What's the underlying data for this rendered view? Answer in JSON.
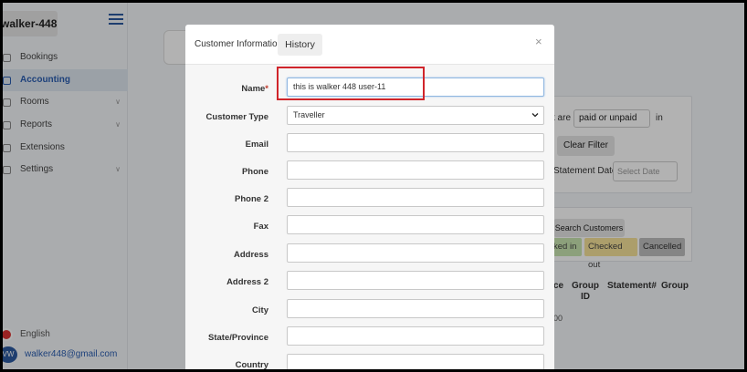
{
  "sidebar": {
    "brand": "walker-448",
    "items": [
      {
        "label": "Bookings",
        "icon": "book-icon",
        "active": false,
        "has_chevron": false
      },
      {
        "label": "Accounting",
        "icon": "user-icon",
        "active": true,
        "has_chevron": false
      },
      {
        "label": "Rooms",
        "icon": "bed-icon",
        "active": false,
        "has_chevron": true
      },
      {
        "label": "Reports",
        "icon": "report-icon",
        "active": false,
        "has_chevron": true
      },
      {
        "label": "Extensions",
        "icon": "extension-icon",
        "active": false,
        "has_chevron": false
      },
      {
        "label": "Settings",
        "icon": "gear-icon",
        "active": false,
        "has_chevron": true
      }
    ],
    "language": "English",
    "user_email": "walker448@gmail.com",
    "avatar_initials": "VW"
  },
  "background": {
    "filter_are_label": "t are",
    "paid_select": "paid or unpaid",
    "in_label": "in",
    "clear_filter": "Clear Filter",
    "statement_date_label": "Statement Date",
    "select_date_placeholder": "Select Date",
    "search_customers": "Search Customers",
    "chips": {
      "checked_in": "ked in",
      "checked_out": "Checked out",
      "cancelled": "Cancelled"
    },
    "table_headers": [
      "ce",
      "Group ID",
      "Statement#",
      "Group"
    ],
    "cell_partial": "00"
  },
  "modal": {
    "tab_info": "Customer Information",
    "tab_history": "History",
    "close": "×",
    "fields": [
      {
        "label": "Name",
        "required": true,
        "value": "this is walker 448 user-11",
        "type": "text"
      },
      {
        "label": "Customer Type",
        "required": false,
        "value": "Traveller",
        "type": "select"
      },
      {
        "label": "Email",
        "required": false,
        "value": "",
        "type": "text"
      },
      {
        "label": "Phone",
        "required": false,
        "value": "",
        "type": "text"
      },
      {
        "label": "Phone 2",
        "required": false,
        "value": "",
        "type": "text"
      },
      {
        "label": "Fax",
        "required": false,
        "value": "",
        "type": "text"
      },
      {
        "label": "Address",
        "required": false,
        "value": "",
        "type": "text"
      },
      {
        "label": "Address 2",
        "required": false,
        "value": "",
        "type": "text"
      },
      {
        "label": "City",
        "required": false,
        "value": "",
        "type": "text"
      },
      {
        "label": "State/Province",
        "required": false,
        "value": "",
        "type": "text"
      },
      {
        "label": "Country",
        "required": false,
        "value": "",
        "type": "text"
      }
    ]
  },
  "colors": {
    "accent": "#2a5db0",
    "highlight": "#d0252b",
    "required": "#c0392b"
  }
}
